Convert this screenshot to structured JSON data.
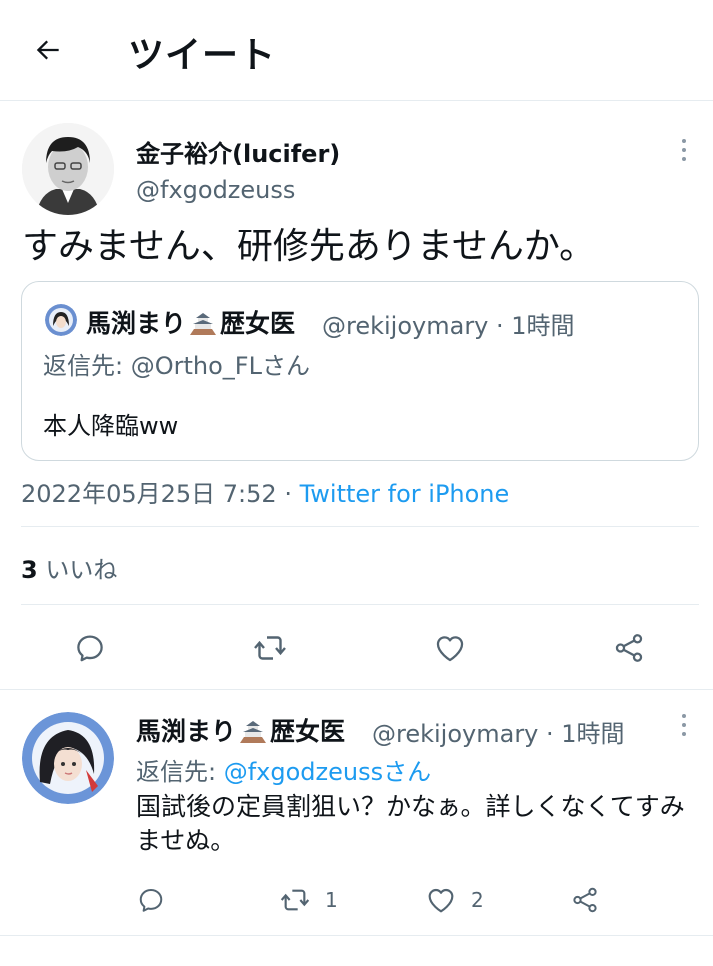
{
  "header": {
    "title": "ツイート",
    "back_icon": "arrow-left-icon"
  },
  "tweet": {
    "author_name": "金子裕介(lucifer)",
    "author_handle": "@fxgodzeuss",
    "text": "すみません、研修先ありませんか。",
    "timestamp": "2022年05月25日 7:52",
    "dot": " · ",
    "via": "Twitter for iPhone",
    "likes_count": "3",
    "likes_label": " いいね"
  },
  "quoted_tweet": {
    "author_name_a": "馬渕まり",
    "author_name_b": "歴女医",
    "author_handle": "@rekijoymary",
    "time": " · 1時間",
    "reply_to": "返信先: @Ortho_FLさん",
    "text": "本人降臨ww"
  },
  "reply": {
    "author_name_a": "馬渕まり",
    "author_name_b": "歴女医",
    "author_handle": "@rekijoymary",
    "time": " · 1時間",
    "reply_prefix": "返信先: ",
    "reply_to": "@fxgodzeussさん",
    "text": "国試後の定員割狙い？かなぁ。詳しくなくてすみませぬ。",
    "retweet_count": "1",
    "like_count": "2"
  },
  "colors": {
    "accent": "#1d9bf0",
    "muted": "#536471",
    "divider": "#e6ecf0",
    "text": "#0f1419"
  },
  "icons": [
    "arrow-left-icon",
    "more-icon",
    "reply-icon",
    "retweet-icon",
    "like-icon",
    "share-icon",
    "castle-emoji-icon"
  ]
}
